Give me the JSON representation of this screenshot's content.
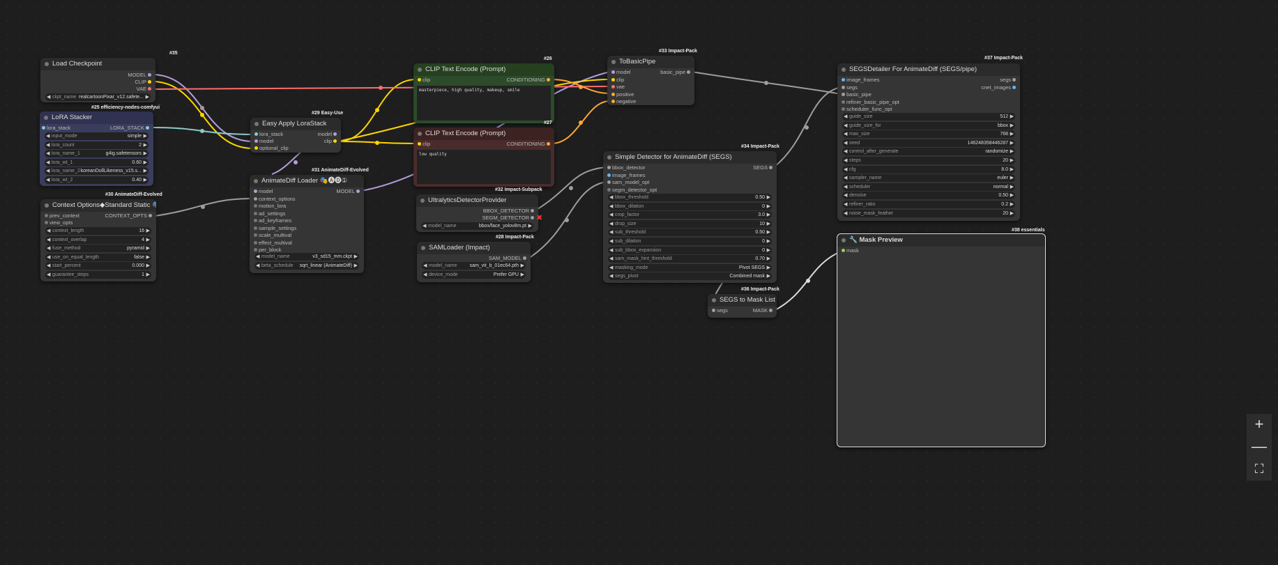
{
  "badges": {
    "n35": "#35",
    "n25": "#25 efficiency-nodes-comfyui",
    "n29": "#29 Easy-Use",
    "n31": "#31 AnimateDiff-Evolved",
    "n30": "#30 AnimateDiff-Evolved",
    "n26": "#26",
    "n27": "#27",
    "n32": "#32 Impact-Subpack",
    "n28": "#28 Impact-Pack",
    "n33": "#33 Impact-Pack",
    "n34": "#34 Impact-Pack",
    "n36": "#36 Impact-Pack",
    "n37": "#37 Impact-Pack",
    "n38": "#38 essentials"
  },
  "load_checkpoint": {
    "title": "Load Checkpoint",
    "out_model": "MODEL",
    "out_clip": "CLIP",
    "out_vae": "VAE",
    "ckpt_label": "ckpt_name",
    "ckpt_value": "realcartoonPixar_v12.safete..."
  },
  "lora_stacker": {
    "title": "LoRA Stacker",
    "in_lora_stack": "lora_stack",
    "out_lora_stack": "LORA_STACK",
    "widgets": [
      {
        "label": "input_mode",
        "value": "simple"
      },
      {
        "label": "lora_count",
        "value": "2"
      },
      {
        "label": "lora_name_1",
        "value": "g4ig.safetensors"
      },
      {
        "label": "lora_wt_1",
        "value": "0.60"
      },
      {
        "label": "lora_name_2",
        "value": "koreanDollLikeness_v15.s..."
      },
      {
        "label": "lora_wt_2",
        "value": "0.40"
      }
    ]
  },
  "easy_lora": {
    "title": "Easy Apply LoraStack",
    "in_lora_stack": "lora_stack",
    "in_model": "model",
    "in_optional_clip": "optional_clip",
    "out_model": "model",
    "out_clip": "clip"
  },
  "animatediff_loader": {
    "title": "AnimateDiff Loader 🎭🅐🅓①",
    "inputs": [
      "model",
      "context_options",
      "motion_lora",
      "ad_settings",
      "ad_keyframes",
      "sample_settings",
      "scale_multival",
      "effect_multival",
      "per_block"
    ],
    "out_model": "MODEL",
    "widgets": [
      {
        "label": "model_name",
        "value": "v3_sd15_mm.ckpt"
      },
      {
        "label": "beta_schedule",
        "value": "sqrt_linear (AnimateDiff)"
      }
    ]
  },
  "context_options": {
    "title": "Context Options◆Standard Static 🎭🅐🅓",
    "in_prev_context": "prev_context",
    "in_view_opts": "view_opts",
    "out": "CONTEXT_OPTS",
    "widgets": [
      {
        "label": "context_length",
        "value": "16"
      },
      {
        "label": "context_overlap",
        "value": "4"
      },
      {
        "label": "fuse_method",
        "value": "pyramid"
      },
      {
        "label": "use_on_equal_length",
        "value": "false"
      },
      {
        "label": "start_percent",
        "value": "0.000"
      },
      {
        "label": "guarantee_steps",
        "value": "1"
      }
    ]
  },
  "clip_pos": {
    "title": "CLIP Text Encode (Prompt)",
    "in_clip": "clip",
    "out": "CONDITIONING",
    "text": "masterpiece, high quality, makeup, smile"
  },
  "clip_neg": {
    "title": "CLIP Text Encode (Prompt)",
    "in_clip": "clip",
    "out": "CONDITIONING",
    "text": "low quality"
  },
  "ultralytics": {
    "title": "UltralyticsDetectorProvider",
    "out_bbox": "BBOX_DETECTOR",
    "out_segm": "SEGM_DETECTOR",
    "model_label": "model_name",
    "model_value": "bbox/face_yolov8m.pt"
  },
  "samloader": {
    "title": "SAMLoader (Impact)",
    "out": "SAM_MODEL",
    "widgets": [
      {
        "label": "model_name",
        "value": "sam_vit_b_01ec64.pth"
      },
      {
        "label": "device_mode",
        "value": "Prefer GPU"
      }
    ]
  },
  "tobasicpipe": {
    "title": "ToBasicPipe",
    "inputs": [
      "model",
      "clip",
      "vae",
      "positive",
      "negative"
    ],
    "out": "basic_pipe"
  },
  "simple_detector": {
    "title": "Simple Detector for AnimateDiff (SEGS)",
    "inputs": [
      "bbox_detector",
      "image_frames",
      "sam_model_opt",
      "segm_detector_opt"
    ],
    "out": "SEGS",
    "widgets": [
      {
        "label": "bbox_threshold",
        "value": "0.50"
      },
      {
        "label": "bbox_dilation",
        "value": "0"
      },
      {
        "label": "crop_factor",
        "value": "3.0"
      },
      {
        "label": "drop_size",
        "value": "10"
      },
      {
        "label": "sub_threshold",
        "value": "0.50"
      },
      {
        "label": "sub_dilation",
        "value": "0"
      },
      {
        "label": "sub_bbox_expansion",
        "value": "0"
      },
      {
        "label": "sam_mask_hint_threshold",
        "value": "0.70"
      },
      {
        "label": "masking_mode",
        "value": "Pivot SEGS"
      },
      {
        "label": "segs_pivot",
        "value": "Combined mask"
      }
    ]
  },
  "segs_to_mask": {
    "title": "SEGS to Mask List",
    "in": "segs",
    "out": "MASK"
  },
  "segs_detailer": {
    "title": "SEGSDetailer For AnimateDiff (SEGS/pipe)",
    "inputs": [
      "image_frames",
      "segs",
      "basic_pipe",
      "refiner_basic_pipe_opt",
      "scheduler_func_opt"
    ],
    "out_segs": "segs",
    "out_cnet": "cnet_images",
    "widgets": [
      {
        "label": "guide_size",
        "value": "512"
      },
      {
        "label": "guide_size_for",
        "value": "bbox"
      },
      {
        "label": "max_size",
        "value": "768"
      },
      {
        "label": "seed",
        "value": "146248358446287"
      },
      {
        "label": "control_after_generate",
        "value": "randomize"
      },
      {
        "label": "steps",
        "value": "20"
      },
      {
        "label": "cfg",
        "value": "8.0"
      },
      {
        "label": "sampler_name",
        "value": "euler"
      },
      {
        "label": "scheduler",
        "value": "normal"
      },
      {
        "label": "denoise",
        "value": "0.50"
      },
      {
        "label": "refiner_ratio",
        "value": "0.2"
      },
      {
        "label": "noise_mask_feather",
        "value": "20"
      }
    ]
  },
  "mask_preview": {
    "title": "🔧 Mask Preview",
    "in": "mask"
  },
  "zoom_controls": {
    "plus": "+",
    "minus": "—",
    "fit": "⛶"
  },
  "colors": {
    "model": "#b39ddb",
    "clip": "#ffd500",
    "vae": "#ff6e6e",
    "conditioning": "#ffa931",
    "generic": "#9e9e9e",
    "pos_node": "#2d4a2a",
    "neg_node": "#4a2b2b",
    "lora_node": "#3a3d5c"
  }
}
